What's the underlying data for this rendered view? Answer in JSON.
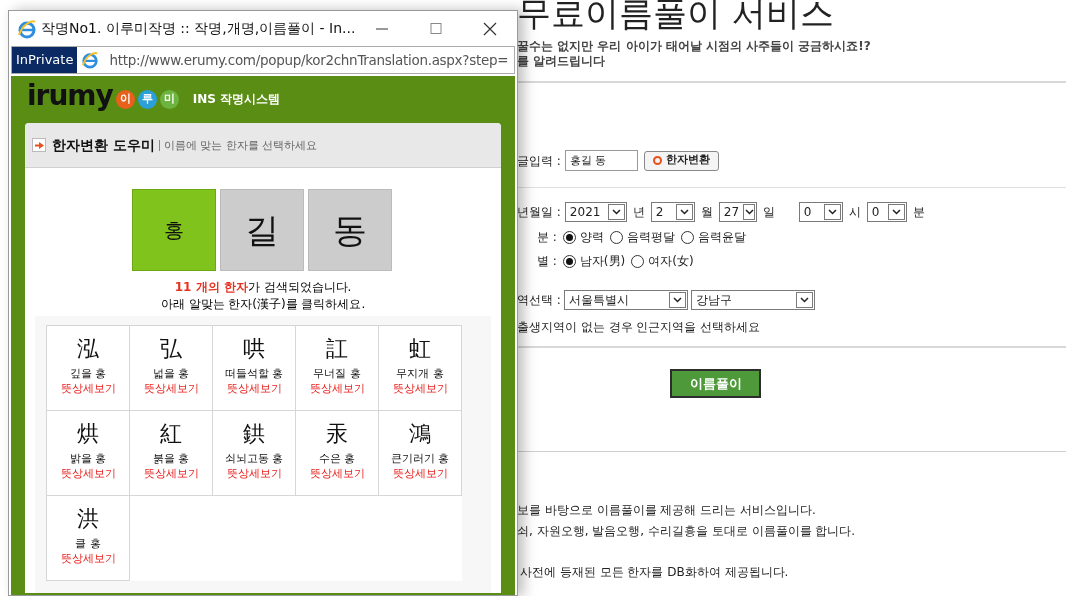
{
  "background_page": {
    "title": "무료이름풀이 서비스",
    "subtitle_lines": [
      "꿀수는 없지만 우리 아이가 태어날 시점의 사주들이 궁금하시죠!?",
      "를 알려드립니다"
    ],
    "name_input": {
      "label": "글입력 :",
      "value": "홍길 동"
    },
    "convert_button": "한자변환",
    "birth": {
      "label": "년월일 :",
      "fields": [
        {
          "value": "2021",
          "unit": "년"
        },
        {
          "value": "2",
          "unit": "월"
        },
        {
          "value": "27",
          "unit": "일"
        },
        {
          "value": "0",
          "unit": "시"
        },
        {
          "value": "0",
          "unit": "분"
        }
      ]
    },
    "calendar": {
      "label": "분 :",
      "options": [
        {
          "label": "양력",
          "selected": true
        },
        {
          "label": "음력평달",
          "selected": false
        },
        {
          "label": "음력윤달",
          "selected": false
        }
      ]
    },
    "gender": {
      "label": "별 :",
      "options": [
        {
          "label": "남자(男)",
          "selected": true
        },
        {
          "label": "여자(女)",
          "selected": false
        }
      ]
    },
    "region": {
      "label": "역선택 :",
      "province": "서울특별시",
      "district": "강남구",
      "hint": "출생지역이 없는 경우 인근지역을 선택하세요"
    },
    "submit_button": "이름풀이",
    "description_lines": [
      "보를 바탕으로 이름풀이를 제공해 드리는 서비스입니다.",
      "쇠, 자원오행, 발음오행, 수리길흉을 토대로 이름풀이를 합니다.",
      "사전에 등재된 모든 한자를 DB화하여 제공됩니다."
    ]
  },
  "popup": {
    "title": "작명No1. 이루미작명 :: 작명,개명,이름풀이 - In...",
    "address_bar": {
      "badge": "InPrivate",
      "url": "http://www.erumy.com/popup/kor2chnTranslation.aspx?step="
    },
    "logo": {
      "wordmark": "irumy",
      "badges": [
        {
          "text": "이",
          "color": "#e8601c"
        },
        {
          "text": "루",
          "color": "#2a9fd8"
        },
        {
          "text": "미",
          "color": "#6cb33f"
        }
      ],
      "system_label": "INS 작명시스템"
    },
    "helper": {
      "title": "한자변환 도우미",
      "subtitle": "이름에 맞는 한자를 선택하세요"
    },
    "name_tiles": [
      {
        "text": "홍",
        "selected": true
      },
      {
        "text": "길",
        "selected": false
      },
      {
        "text": "동",
        "selected": false
      }
    ],
    "result": {
      "count": "11 개의 한자",
      "rest": "가 검색되었습니다.",
      "instruction": "아래 알맞는 한자(漢子)를 클릭하세요."
    },
    "hanja": [
      {
        "char": "泓",
        "meaning": "깊을 홍",
        "link": "뜻상세보기"
      },
      {
        "char": "弘",
        "meaning": "넓을 홍",
        "link": "뜻상세보기"
      },
      {
        "char": "哄",
        "meaning": "떠들석할 홍",
        "link": "뜻상세보기"
      },
      {
        "char": "訌",
        "meaning": "무너질 홍",
        "link": "뜻상세보기"
      },
      {
        "char": "虹",
        "meaning": "무지개 홍",
        "link": "뜻상세보기"
      },
      {
        "char": "烘",
        "meaning": "밝을 홍",
        "link": "뜻상세보기"
      },
      {
        "char": "紅",
        "meaning": "붉을 홍",
        "link": "뜻상세보기"
      },
      {
        "char": "鉷",
        "meaning": "쇠뇌고동 홍",
        "link": "뜻상세보기"
      },
      {
        "char": "汞",
        "meaning": "수은 홍",
        "link": "뜻상세보기"
      },
      {
        "char": "鴻",
        "meaning": "큰기러기 홍",
        "link": "뜻상세보기"
      },
      {
        "char": "洪",
        "meaning": "클 홍",
        "link": "뜻상세보기"
      }
    ]
  }
}
